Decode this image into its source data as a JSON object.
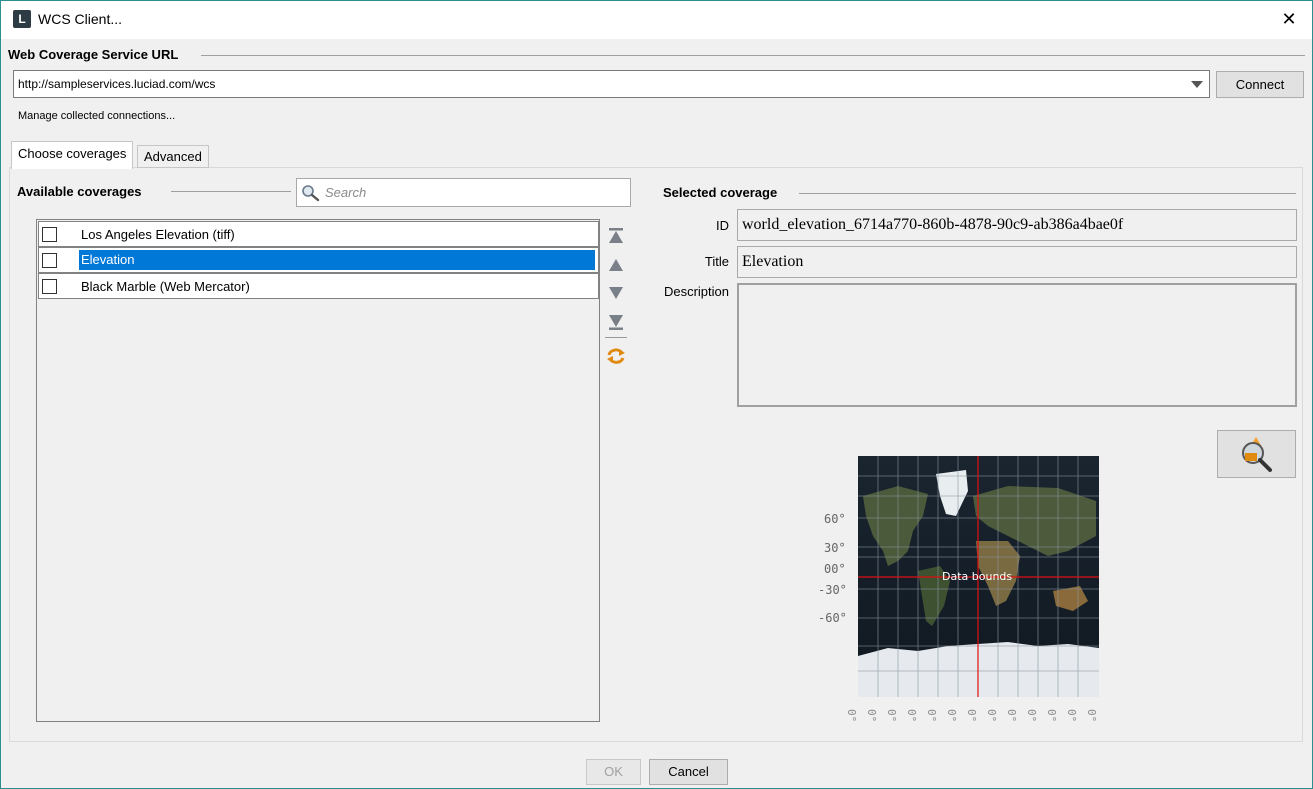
{
  "window": {
    "title": "WCS Client...",
    "close_symbol": "✕",
    "app_icon_letter": "L"
  },
  "url_section": {
    "heading": "Web Coverage Service URL",
    "url_value": "http://sampleservices.luciad.com/wcs",
    "connect_label": "Connect",
    "manage_link": "Manage collected connections..."
  },
  "tabs": [
    {
      "label": "Choose coverages",
      "active": true
    },
    {
      "label": "Advanced",
      "active": false
    }
  ],
  "available": {
    "heading": "Available coverages",
    "search_placeholder": "Search",
    "items": [
      {
        "label": "Los Angeles Elevation (tiff)",
        "checked": false,
        "selected": false
      },
      {
        "label": "Elevation",
        "checked": false,
        "selected": true
      },
      {
        "label": "Black Marble (Web Mercator)",
        "checked": false,
        "selected": false
      }
    ],
    "tools": [
      "move-to-top-icon",
      "move-up-icon",
      "move-down-icon",
      "move-to-bottom-icon",
      "refresh-icon"
    ]
  },
  "selected": {
    "heading": "Selected coverage",
    "id_label": "ID",
    "id_value": "world_elevation_6714a770-860b-4878-90c9-ab386a4bae0f",
    "title_label": "Title",
    "title_value": "Elevation",
    "description_label": "Description",
    "description_value": ""
  },
  "preview": {
    "bounds_label": "Data bounds",
    "lat_labels": [
      "60°",
      "30°",
      "00°",
      "-30°",
      "-60°"
    ],
    "lon_tick_count": 13
  },
  "footer": {
    "ok_label": "OK",
    "cancel_label": "Cancel"
  },
  "colors": {
    "selection": "#0078d7",
    "window_border": "#2b8f8f",
    "bounds_line": "#e01010"
  }
}
